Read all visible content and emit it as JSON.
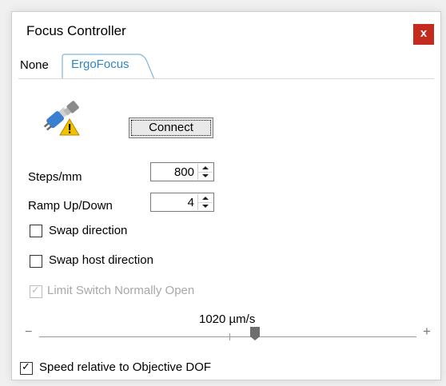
{
  "window": {
    "title": "Focus Controller",
    "close_label": "x"
  },
  "tabs": [
    {
      "label": "None",
      "active": false
    },
    {
      "label": "ErgoFocus",
      "active": true
    }
  ],
  "connect": {
    "button_label": "Connect",
    "icon": "plug-warning-icon"
  },
  "fields": {
    "steps": {
      "label": "Steps/mm",
      "value": "800"
    },
    "ramp": {
      "label": "Ramp Up/Down",
      "value": "4"
    }
  },
  "checkboxes": {
    "swap_direction": {
      "label": "Swap direction",
      "checked": false,
      "enabled": true
    },
    "swap_host_direction": {
      "label": "Swap host direction",
      "checked": false,
      "enabled": true
    },
    "limit_switch": {
      "label": "Limit Switch Normally Open",
      "checked": true,
      "enabled": false
    },
    "speed_relative": {
      "label": "Speed relative to Objective DOF",
      "checked": true,
      "enabled": true
    }
  },
  "speed": {
    "value_text": "1020 µm/s",
    "minus": "−",
    "plus": "+",
    "level": 0.57
  },
  "colors": {
    "accent": "#2e86c8",
    "close": "#c42b1c",
    "warning": "#f2c200"
  }
}
